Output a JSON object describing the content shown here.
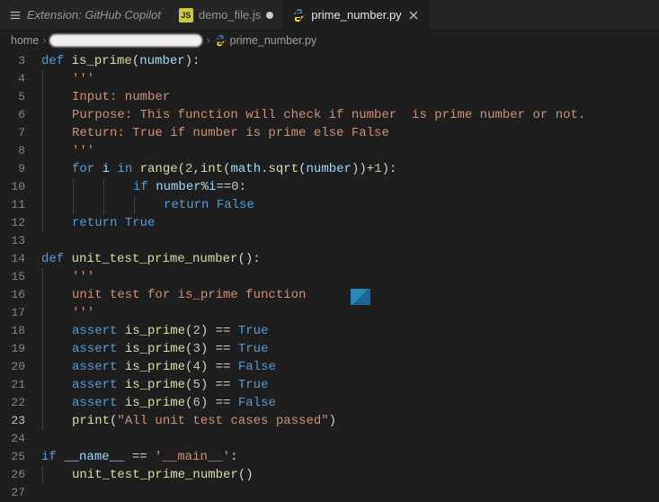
{
  "tabs": [
    {
      "label": "Extension: GitHub Copilot",
      "icon": "list-icon",
      "italic": true,
      "dirty": false,
      "active": false
    },
    {
      "label": "demo_file.js",
      "icon": "js-icon",
      "italic": false,
      "dirty": true,
      "active": false
    },
    {
      "label": "prime_number.py",
      "icon": "py-icon",
      "italic": false,
      "dirty": false,
      "active": true
    }
  ],
  "breadcrumb": {
    "root": "home",
    "file": "prime_number.py",
    "file_icon": "py-icon"
  },
  "active_line": 23,
  "code_lines": [
    {
      "n": 3,
      "indent": 0,
      "tokens": [
        [
          "kw",
          "def "
        ],
        [
          "fn",
          "is_prime"
        ],
        [
          "pn",
          "("
        ],
        [
          "var",
          "number"
        ],
        [
          "pn",
          "):"
        ]
      ]
    },
    {
      "n": 4,
      "indent": 1,
      "tokens": [
        [
          "str",
          "'''"
        ]
      ]
    },
    {
      "n": 5,
      "indent": 1,
      "tokens": [
        [
          "str",
          "Input: number"
        ]
      ]
    },
    {
      "n": 6,
      "indent": 1,
      "tokens": [
        [
          "str",
          "Purpose: This function will check if number  is prime number or not."
        ]
      ]
    },
    {
      "n": 7,
      "indent": 1,
      "tokens": [
        [
          "str",
          "Return: True if number is prime else False"
        ]
      ]
    },
    {
      "n": 8,
      "indent": 1,
      "tokens": [
        [
          "str",
          "'''"
        ]
      ]
    },
    {
      "n": 9,
      "indent": 1,
      "tokens": [
        [
          "kw",
          "for "
        ],
        [
          "var",
          "i"
        ],
        [
          "kw",
          " in "
        ],
        [
          "fn",
          "range"
        ],
        [
          "pn",
          "("
        ],
        [
          "num",
          "2"
        ],
        [
          "pn",
          ","
        ],
        [
          "fn",
          "int"
        ],
        [
          "pn",
          "("
        ],
        [
          "var",
          "math"
        ],
        [
          "pn",
          "."
        ],
        [
          "fn",
          "sqrt"
        ],
        [
          "pn",
          "("
        ],
        [
          "var",
          "number"
        ],
        [
          "pn",
          "))"
        ],
        [
          "op",
          "+"
        ],
        [
          "num",
          "1"
        ],
        [
          "pn",
          "):"
        ]
      ]
    },
    {
      "n": 10,
      "indent": 3,
      "tokens": [
        [
          "kw",
          "if "
        ],
        [
          "var",
          "number"
        ],
        [
          "op",
          "%"
        ],
        [
          "var",
          "i"
        ],
        [
          "op",
          "=="
        ],
        [
          "num",
          "0"
        ],
        [
          "pn",
          ":"
        ]
      ]
    },
    {
      "n": 11,
      "indent": 4,
      "tokens": [
        [
          "kw",
          "return "
        ],
        [
          "const",
          "False"
        ]
      ]
    },
    {
      "n": 12,
      "indent": 1,
      "tokens": [
        [
          "kw",
          "return "
        ],
        [
          "const",
          "True"
        ]
      ]
    },
    {
      "n": 13,
      "indent": 0,
      "tokens": []
    },
    {
      "n": 14,
      "indent": 0,
      "tokens": [
        [
          "kw",
          "def "
        ],
        [
          "fn",
          "unit_test_prime_number"
        ],
        [
          "pn",
          "():"
        ]
      ]
    },
    {
      "n": 15,
      "indent": 1,
      "tokens": [
        [
          "str",
          "'''"
        ]
      ]
    },
    {
      "n": 16,
      "indent": 1,
      "tokens": [
        [
          "str",
          "unit test for is_prime function"
        ]
      ]
    },
    {
      "n": 17,
      "indent": 1,
      "tokens": [
        [
          "str",
          "'''"
        ]
      ]
    },
    {
      "n": 18,
      "indent": 1,
      "tokens": [
        [
          "kw",
          "assert "
        ],
        [
          "fn",
          "is_prime"
        ],
        [
          "pn",
          "("
        ],
        [
          "num",
          "2"
        ],
        [
          "pn",
          ") "
        ],
        [
          "op",
          "== "
        ],
        [
          "const",
          "True"
        ]
      ]
    },
    {
      "n": 19,
      "indent": 1,
      "tokens": [
        [
          "kw",
          "assert "
        ],
        [
          "fn",
          "is_prime"
        ],
        [
          "pn",
          "("
        ],
        [
          "num",
          "3"
        ],
        [
          "pn",
          ") "
        ],
        [
          "op",
          "== "
        ],
        [
          "const",
          "True"
        ]
      ]
    },
    {
      "n": 20,
      "indent": 1,
      "tokens": [
        [
          "kw",
          "assert "
        ],
        [
          "fn",
          "is_prime"
        ],
        [
          "pn",
          "("
        ],
        [
          "num",
          "4"
        ],
        [
          "pn",
          ") "
        ],
        [
          "op",
          "== "
        ],
        [
          "const",
          "False"
        ]
      ]
    },
    {
      "n": 21,
      "indent": 1,
      "tokens": [
        [
          "kw",
          "assert "
        ],
        [
          "fn",
          "is_prime"
        ],
        [
          "pn",
          "("
        ],
        [
          "num",
          "5"
        ],
        [
          "pn",
          ") "
        ],
        [
          "op",
          "== "
        ],
        [
          "const",
          "True"
        ]
      ]
    },
    {
      "n": 22,
      "indent": 1,
      "tokens": [
        [
          "kw",
          "assert "
        ],
        [
          "fn",
          "is_prime"
        ],
        [
          "pn",
          "("
        ],
        [
          "num",
          "6"
        ],
        [
          "pn",
          ") "
        ],
        [
          "op",
          "== "
        ],
        [
          "const",
          "False"
        ]
      ]
    },
    {
      "n": 23,
      "indent": 1,
      "tokens": [
        [
          "fn",
          "print"
        ],
        [
          "pn",
          "("
        ],
        [
          "str",
          "\"All unit test cases passed\""
        ],
        [
          "pn",
          ")"
        ]
      ]
    },
    {
      "n": 24,
      "indent": 0,
      "tokens": []
    },
    {
      "n": 25,
      "indent": 0,
      "tokens": [
        [
          "kw",
          "if "
        ],
        [
          "dund",
          "__name__"
        ],
        [
          "op",
          " == "
        ],
        [
          "str",
          "'__main__'"
        ],
        [
          "pn",
          ":"
        ]
      ]
    },
    {
      "n": 26,
      "indent": 1,
      "tokens": [
        [
          "fn",
          "unit_test_prime_number"
        ],
        [
          "pn",
          "()"
        ]
      ]
    },
    {
      "n": 27,
      "indent": 0,
      "tokens": []
    }
  ],
  "icons": {
    "js_label": "JS"
  }
}
